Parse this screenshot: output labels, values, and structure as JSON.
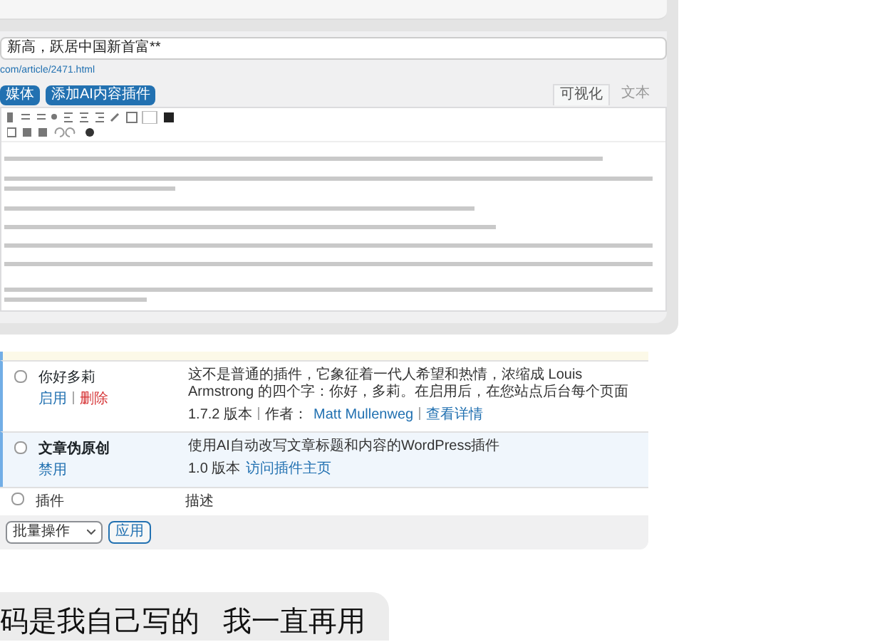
{
  "editor": {
    "title_value": "新高，跃居中国新首富**",
    "permalink": "com/article/2471.html",
    "buttons": [
      "媒体",
      "添加AI内容插件"
    ],
    "tabs": [
      {
        "label": "可视化",
        "selected": true
      },
      {
        "label": "文本",
        "selected": false
      }
    ]
  },
  "plugins": {
    "rows": [
      {
        "name": "你好多莉",
        "checked": false,
        "active": false,
        "actions": [
          {
            "label": "启用",
            "kind": "normal"
          },
          {
            "label": "删除",
            "kind": "danger"
          }
        ],
        "description": "这不是普通的插件，它象征着一代人希望和热情，浓缩成 Louis Armstrong 的四个字：你好，多莉。在启用后，在您站点后台每个页面",
        "meta": [
          {
            "label": "1.7.2 版本",
            "kind": "text"
          },
          {
            "label": "作者：",
            "kind": "text"
          },
          {
            "label": "Matt Mullenweg",
            "kind": "link"
          },
          {
            "label": "查看详情",
            "kind": "link"
          }
        ]
      },
      {
        "name": "文章伪原创",
        "checked": false,
        "active": true,
        "actions": [
          {
            "label": "禁用",
            "kind": "normal"
          }
        ],
        "description": "使用AI自动改写文章标题和内容的WordPress插件",
        "meta": [
          {
            "label": "1.0 版本",
            "kind": "text"
          },
          {
            "label": "访问插件主页",
            "kind": "link"
          }
        ]
      }
    ],
    "footer": {
      "checked": false,
      "column_1": "插件",
      "column_2": "描述"
    },
    "bulk_select": "批量操作",
    "apply_button": "应用"
  },
  "chat_bubble": {
    "text": "码是我自己写的   我一直再用"
  }
}
